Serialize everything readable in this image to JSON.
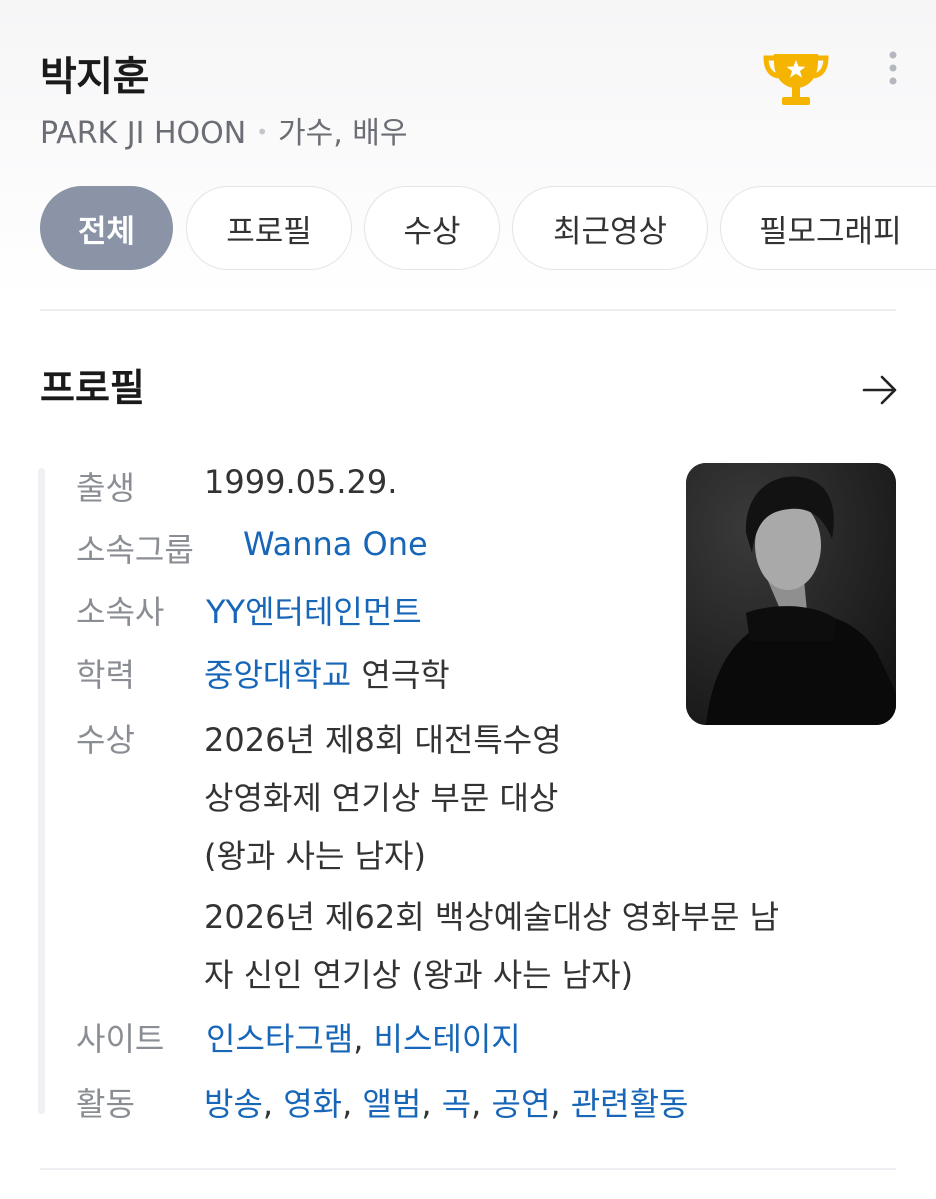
{
  "header": {
    "name": "박지훈",
    "english_name": "PARK JI HOON",
    "separator": "•",
    "occupation": "가수, 배우",
    "trophy_icon": "trophy-icon",
    "more_icon": "more-vertical-icon"
  },
  "tabs": [
    {
      "label": "전체",
      "active": true
    },
    {
      "label": "프로필",
      "active": false
    },
    {
      "label": "수상",
      "active": false
    },
    {
      "label": "최근영상",
      "active": false
    },
    {
      "label": "필모그래피",
      "active": false
    }
  ],
  "profile": {
    "title": "프로필",
    "arrow_icon": "arrow-right-icon",
    "birth": {
      "label": "출생",
      "value": "1999.05.29."
    },
    "group": {
      "label": "소속그룹",
      "value": "Wanna One"
    },
    "agency": {
      "label": "소속사",
      "value": "YY엔터테인먼트"
    },
    "education": {
      "label": "학력",
      "school": "중앙대학교",
      "major": "연극학"
    },
    "awards": {
      "label": "수상",
      "lines": [
        "2026년 제8회 대전특수영",
        "상영화제 연기상 부문 대상",
        "(왕과 사는 남자)",
        "2026년 제62회 백상예술대상 영화부문 남",
        "자 신인 연기상 (왕과 사는 남자)"
      ]
    },
    "site": {
      "label": "사이트",
      "links": [
        "인스타그램",
        "비스테이지"
      ],
      "sep": ","
    },
    "activity": {
      "label": "활동",
      "links": [
        "방송",
        "영화",
        "앨범",
        "곡",
        "공연",
        "관련활동"
      ],
      "sep": ","
    }
  },
  "colors": {
    "link": "#1766b8",
    "active_tab": "#8a94a6",
    "trophy": "#f5b400",
    "label": "#8a8d93"
  }
}
